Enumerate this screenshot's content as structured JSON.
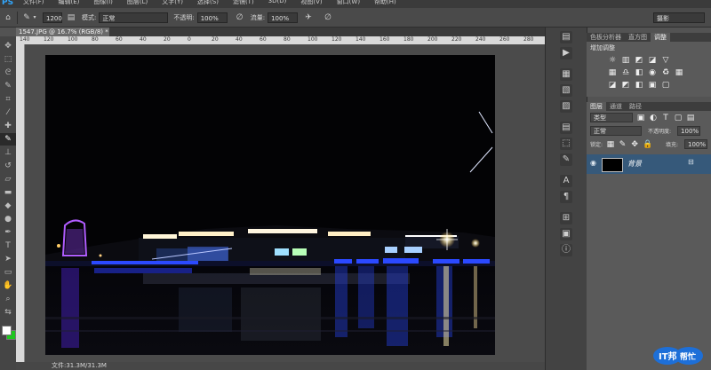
{
  "app": {
    "logo": "PS"
  },
  "menu": [
    "文件(F)",
    "编辑(E)",
    "图像(I)",
    "图层(L)",
    "文字(Y)",
    "选择(S)",
    "滤镜(T)",
    "3D(D)",
    "视图(V)",
    "窗口(W)",
    "帮助(H)"
  ],
  "options": {
    "brush_size": "1200",
    "mode_label": "模式:",
    "mode_value": "正常",
    "opacity_label": "不透明:",
    "opacity_value": "100%",
    "flow_label": "流量:",
    "flow_value": "100%",
    "workspace": "摄影"
  },
  "document": {
    "tab_title": "1547.JPG @ 16.7% (RGB/8) *",
    "ruler_ticks": [
      "140",
      "120",
      "100",
      "80",
      "60",
      "40",
      "20",
      "0",
      "20",
      "40",
      "60",
      "80",
      "100",
      "120",
      "140",
      "160",
      "180",
      "200",
      "220",
      "240",
      "260",
      "280"
    ],
    "status": "文件:31.3M/31.3M"
  },
  "panels": {
    "top_tabs": [
      "色板分析器",
      "直方图",
      "调整"
    ],
    "adjust_title": "增加调整",
    "layer_tabs": [
      "图层",
      "通道",
      "路径"
    ],
    "kind_label": "类型",
    "blend_mode": "正常",
    "opacity_label": "不透明度:",
    "opacity_value": "100%",
    "lock_label": "锁定:",
    "fill_label": "填充:",
    "fill_value": "100%",
    "layer_name": "背景"
  },
  "watermark": {
    "text": "IT邦帮忙"
  },
  "colors": {
    "foreground": "#ffffff",
    "background": "#1ec61e",
    "selected_layer": "#36597a"
  }
}
